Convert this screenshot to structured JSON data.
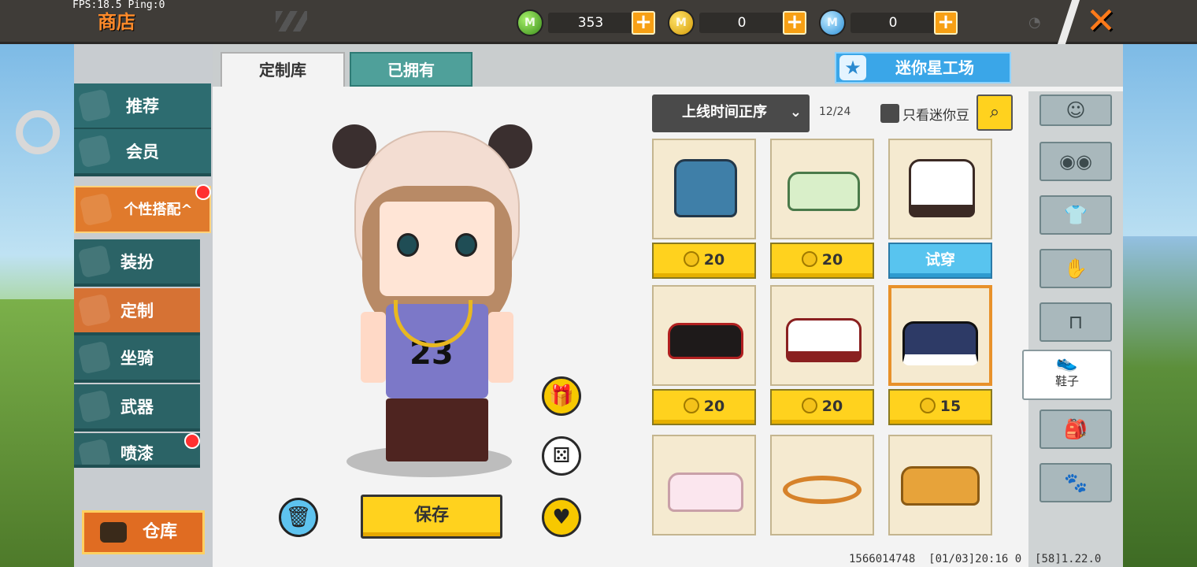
{
  "debug": {
    "fps": "FPS:18.5",
    "ping": "Ping:0"
  },
  "header": {
    "title": "商店"
  },
  "currencies": [
    {
      "icon": "green-gem-icon",
      "value": "353"
    },
    {
      "icon": "gold-coin-icon",
      "value": "0"
    },
    {
      "icon": "mini-bean-icon",
      "value": "0"
    }
  ],
  "sidebar": {
    "items": [
      {
        "label": "推荐"
      },
      {
        "label": "会员"
      },
      {
        "label": "个性搭配"
      },
      {
        "label": "装扮"
      },
      {
        "label": "定制"
      },
      {
        "label": "坐骑"
      },
      {
        "label": "武器"
      },
      {
        "label": "喷漆"
      }
    ],
    "warehouse_label": "仓库"
  },
  "tabs": [
    {
      "label": "定制库"
    },
    {
      "label": "已拥有"
    }
  ],
  "workshop_label": "迷你星工场",
  "save_label": "保存",
  "character": {
    "shirt_number": "23"
  },
  "filters": {
    "sort_label": "上线时间正序",
    "page": "12/24",
    "only_mini_bean_label": "只看迷你豆"
  },
  "items": [
    {
      "price": "20",
      "action": "price"
    },
    {
      "price": "20",
      "action": "price"
    },
    {
      "price": "试穿",
      "action": "try"
    },
    {
      "price": "20",
      "action": "price"
    },
    {
      "price": "20",
      "action": "price"
    },
    {
      "price": "15",
      "action": "price"
    }
  ],
  "categories": {
    "active_label": "鞋子"
  },
  "footer": {
    "id": "1566014748",
    "time": "[01/03]20:16 0",
    "version": "[58]1.22.0"
  },
  "colors": {
    "accent": "#e07a2c",
    "teal": "#2d6c70",
    "yellow": "#ffd21e"
  }
}
